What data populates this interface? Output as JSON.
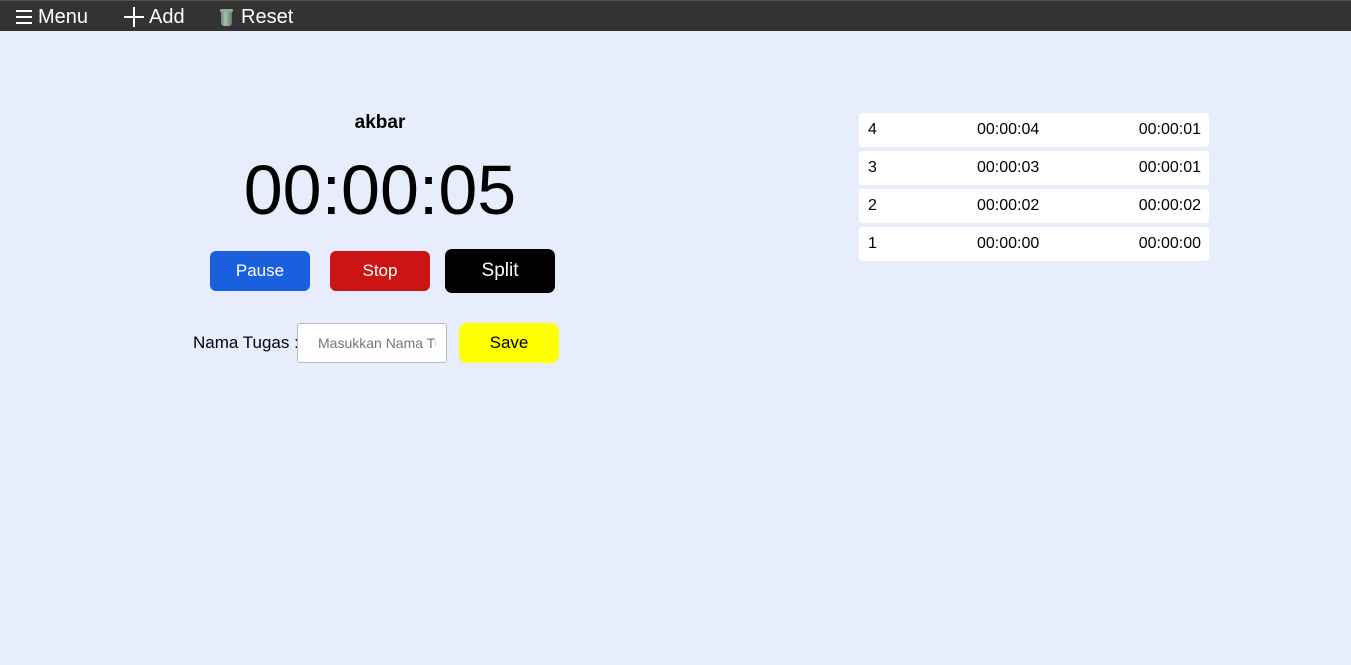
{
  "topbar": {
    "menu_label": "Menu",
    "add_label": "Add",
    "reset_label": "Reset",
    "bg_color": "#333333"
  },
  "stopwatch": {
    "task_name": "akbar",
    "time": "00:00:05",
    "pause_label": "Pause",
    "stop_label": "Stop",
    "split_label": "Split"
  },
  "task_form": {
    "label": "Nama Tugas :",
    "input_value": "",
    "input_placeholder": "Masukkan Nama Tugas",
    "save_label": "Save"
  },
  "laps": [
    {
      "num": "4",
      "time": "00:00:04",
      "diff": "00:00:01"
    },
    {
      "num": "3",
      "time": "00:00:03",
      "diff": "00:00:01"
    },
    {
      "num": "2",
      "time": "00:00:02",
      "diff": "00:00:02"
    },
    {
      "num": "1",
      "time": "00:00:00",
      "diff": "00:00:00"
    }
  ],
  "colors": {
    "background": "#e7edfd",
    "pause": "#1a5fde",
    "stop": "#cc1414",
    "split": "#000000",
    "save": "#ffff00"
  }
}
